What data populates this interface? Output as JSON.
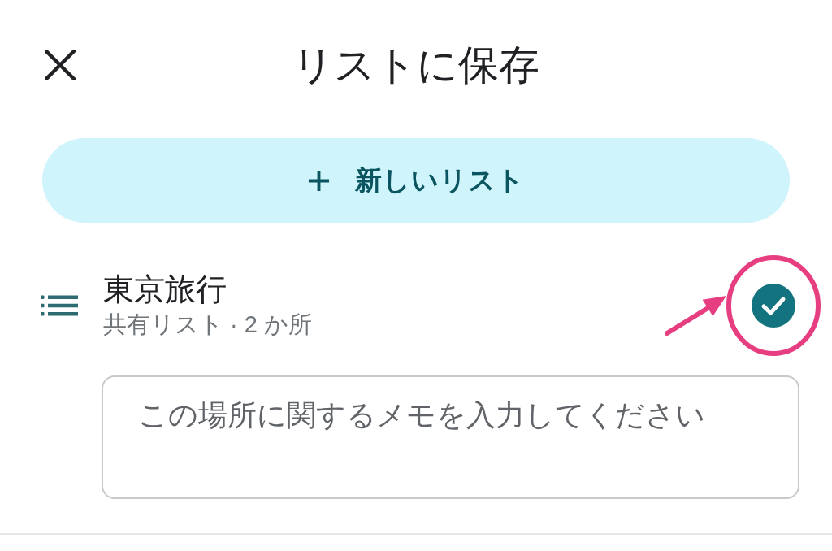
{
  "header": {
    "title": "リストに保存"
  },
  "new_list_button": {
    "label": "新しいリスト"
  },
  "lists": [
    {
      "name": "東京旅行",
      "details": "共有リスト · 2 か所",
      "checked": true,
      "highlighted": true,
      "note": {
        "placeholder": "この場所に関するメモを入力してください"
      }
    }
  ]
}
